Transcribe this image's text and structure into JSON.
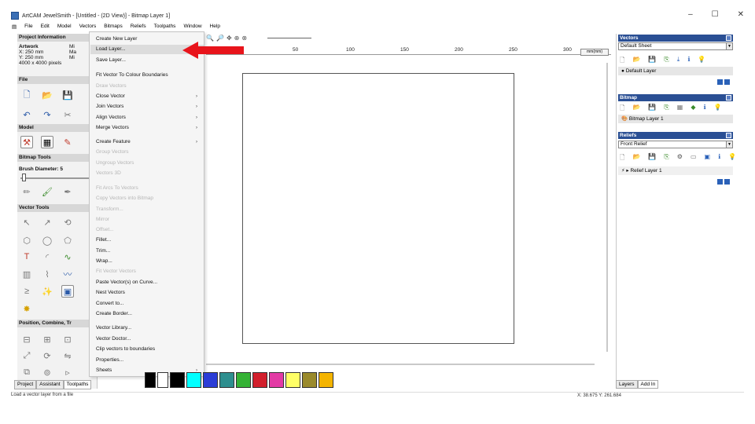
{
  "window": {
    "title": "ArtCAM JewelSmith - [Untitled - (2D View)] - Bitmap Layer 1]",
    "buttons": [
      "–",
      "☐",
      "✕"
    ]
  },
  "menubar": {
    "items": [
      "File",
      "Edit",
      "Model",
      "Vectors",
      "Bitmaps",
      "Reliefs",
      "Toolpaths",
      "Window",
      "Help"
    ]
  },
  "left_panel": {
    "project_info": {
      "header": "Project Information",
      "artwork_label": "Artwork",
      "x_line": "X: 250 mm",
      "y_line": "Y: 250 mm",
      "pixels": "4000 x 4000 pixels",
      "col2_a": "Mi",
      "col2_b": "Ma",
      "col2_c": "Mi"
    },
    "file_header": "File",
    "model_header": "Model",
    "bitmap_tools_header": "Bitmap Tools",
    "brush_diameter": "Brush Diameter: 5",
    "vector_tools_header": "Vector Tools",
    "position_header": "Position, Combine, Tr",
    "tabs": [
      "Project",
      "Assistant",
      "Toolpaths"
    ]
  },
  "dropdown": {
    "items": [
      {
        "label": "Create New Layer",
        "disabled": false,
        "arrow": false
      },
      {
        "label": "Load Layer...",
        "disabled": false,
        "arrow": false
      },
      {
        "label": "Save Layer...",
        "disabled": false,
        "arrow": false
      },
      {
        "label": "Fit Vector To Colour Boundaries",
        "disabled": false,
        "arrow": false
      },
      {
        "label": "Draw Vectors",
        "disabled": true,
        "arrow": false
      },
      {
        "label": "Close Vector",
        "disabled": false,
        "arrow": true
      },
      {
        "label": "Join Vectors",
        "disabled": false,
        "arrow": true
      },
      {
        "label": "Align Vectors",
        "disabled": false,
        "arrow": true
      },
      {
        "label": "Merge Vectors",
        "disabled": false,
        "arrow": true
      },
      {
        "label": "Create Feature",
        "disabled": false,
        "arrow": true
      },
      {
        "label": "Group Vectors",
        "disabled": true,
        "arrow": false
      },
      {
        "label": "Ungroup Vectors",
        "disabled": true,
        "arrow": false
      },
      {
        "label": "Vectors 3D",
        "disabled": true,
        "arrow": false
      },
      {
        "label": "Fit Arcs To Vectors",
        "disabled": true,
        "arrow": false
      },
      {
        "label": "Copy Vectors into Bitmap",
        "disabled": true,
        "arrow": false
      },
      {
        "label": "Transform...",
        "disabled": true,
        "arrow": false
      },
      {
        "label": "Mirror",
        "disabled": true,
        "arrow": false
      },
      {
        "label": "Offset...",
        "disabled": true,
        "arrow": false
      },
      {
        "label": "Fillet...",
        "disabled": false,
        "arrow": false
      },
      {
        "label": "Trim...",
        "disabled": false,
        "arrow": false
      },
      {
        "label": "Wrap...",
        "disabled": false,
        "arrow": false
      },
      {
        "label": "Fit Vector Vectors",
        "disabled": true,
        "arrow": false
      },
      {
        "label": "Paste Vector(s) on Curve...",
        "disabled": false,
        "arrow": false
      },
      {
        "label": "Nest Vectors",
        "disabled": false,
        "arrow": false
      },
      {
        "label": "Convert to...",
        "disabled": false,
        "arrow": false
      },
      {
        "label": "Create Border...",
        "disabled": false,
        "arrow": false
      },
      {
        "label": "Vector Library...",
        "disabled": false,
        "arrow": false
      },
      {
        "label": "Vector Doctor...",
        "disabled": false,
        "arrow": false
      },
      {
        "label": "Clip vectors to boundaries",
        "disabled": false,
        "arrow": false
      },
      {
        "label": "Properties...",
        "disabled": false,
        "arrow": false
      },
      {
        "label": "Sheets",
        "disabled": false,
        "arrow": true
      }
    ]
  },
  "ruler": {
    "ticks": [
      "50",
      "100",
      "150",
      "200",
      "250",
      "300"
    ],
    "unit_box": "mm(mm)"
  },
  "palette": {
    "colors": [
      "#000000",
      "#ffffff",
      "#000000",
      "#00ffff",
      "#2b3dd6",
      "#2e8f8f",
      "#35b235",
      "#d21f2c",
      "#e33aa5",
      "#ffff66",
      "#9a8a2c",
      "#f4b400"
    ]
  },
  "right_panel": {
    "vectors": {
      "header": "Vectors",
      "select": "Default Sheet",
      "layer": "Default Layer"
    },
    "bitmap": {
      "header": "Bitmap",
      "layer": "Bitmap Layer 1"
    },
    "reliefs": {
      "header": "Reliefs",
      "select": "Front Relief",
      "layer": "Relief Layer 1"
    },
    "tabs": [
      "Layers",
      "Add In"
    ]
  },
  "statusbar": {
    "message": "Load a vector layer from a file",
    "coords": "X: 38.675    Y: 261.684"
  }
}
